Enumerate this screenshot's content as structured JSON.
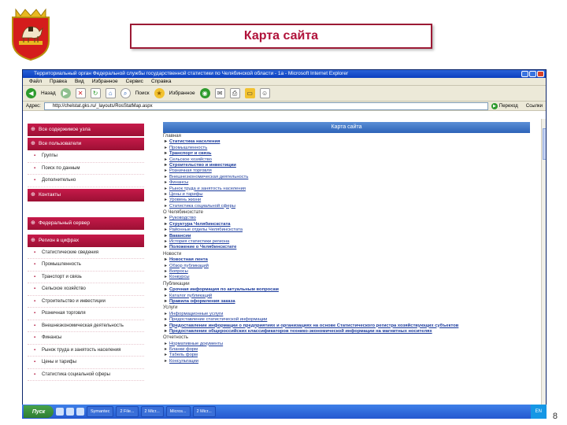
{
  "slide": {
    "title": "Карта сайта",
    "number": "8",
    "accent_color": "#b0123a"
  },
  "browser": {
    "title": "Территориальный орган Федеральной службы государственной статистики по Челябинской области - 1a - Microsoft Internet Explorer",
    "menu": [
      "Файл",
      "Правка",
      "Вид",
      "Избранное",
      "Сервис",
      "Справка"
    ],
    "toolbar": {
      "back_label": "Назад",
      "search_label": "Поиск",
      "favorites_label": "Избранное"
    },
    "address": {
      "label": "Адрес:",
      "value": "http://chelstat.gks.ru/_layouts/RosStatMap.aspx",
      "go_label": "Переход",
      "links_label": "Ссылки"
    }
  },
  "sidebar": {
    "groups": [
      {
        "header": "Все содержимое узла",
        "items": []
      },
      {
        "header": "Все пользователи",
        "items": [
          "Группы",
          "Поиск по данным",
          "Дополнительно"
        ]
      },
      {
        "header": "Контакты",
        "items": []
      },
      {
        "header": "Федеральный сервер",
        "items": []
      },
      {
        "header": "Регион в цифрах",
        "items": [
          "Статистические сведения",
          "Промышленность",
          "Транспорт и связь",
          "Сельское хозяйство",
          "Строительство и инвестиции",
          "Розничная торговля",
          "Внешнеэкономическая деятельность",
          "Финансы",
          "Рынок труда и занятость населения",
          "Цены и тарифы",
          "Статистика социальной сферы"
        ]
      }
    ]
  },
  "main": {
    "header": "Карта сайта",
    "sections": [
      {
        "title": "Главная",
        "links": [
          "Статистика населения",
          "Промышленность",
          "Транспорт и связь",
          "Сельское хозяйство",
          "Строительство и инвестиции",
          "Розничная торговля",
          "Внешнеэкономическая деятельность",
          "Финансы",
          "Рынок труда и занятость населения",
          "Цены и тарифы",
          "Уровень жизни",
          "Статистика социальной сферы"
        ]
      },
      {
        "title": "О Челябинскстате",
        "links": [
          "Руководство",
          "Структура Челябинскстата",
          "Районные отделы Челябинскстата",
          "Вакансии",
          "История статистики региона",
          "Положение о Челябинскстате"
        ]
      },
      {
        "title": "Новости",
        "links": [
          "Новостная лента",
          "Обзор публикаций",
          "Вопросы",
          "Конкурсы"
        ]
      },
      {
        "title": "Публикации",
        "links": [
          "Срочная информация по актуальным вопросам",
          "Каталог публикаций",
          "Правила оформления заказа"
        ]
      },
      {
        "title": "Услуги",
        "links": [
          "Информационные услуги",
          "Предоставление статистической информации",
          "Предоставление информации о предприятиях и организациях на основе Статистического регистра хозяйствующих субъектов",
          "Предоставление общероссийских классификаторов технико-экономической информации на магнитных носителях"
        ]
      },
      {
        "title": "Отчетность",
        "links": [
          "Нормативные документы",
          "Бланки форм",
          "Табель форм",
          "Консультации"
        ]
      }
    ]
  },
  "taskbar": {
    "start_label": "Пуск",
    "buttons": [
      "Symantec",
      "2 File...",
      "2 Micr...",
      "Micros...",
      "2 Micr..."
    ],
    "lang": "EN"
  }
}
